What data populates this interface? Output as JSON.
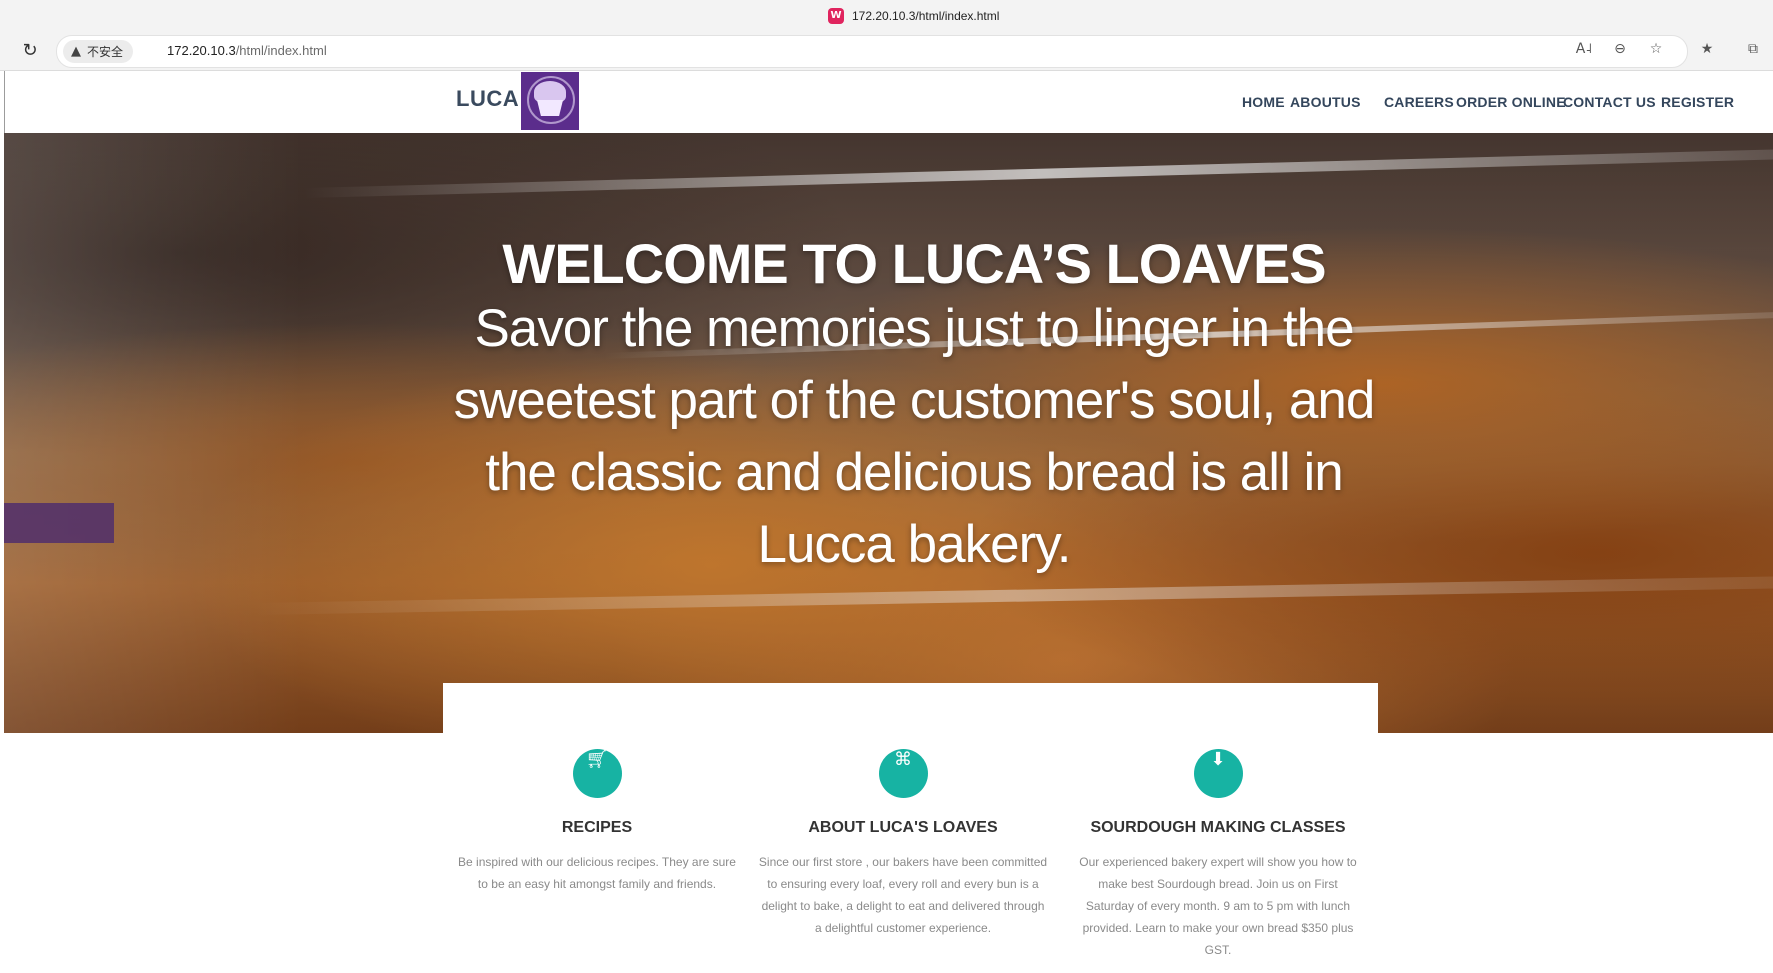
{
  "browser": {
    "tab_title": "172.20.10.3/html/index.html",
    "security_label": "不安全",
    "url_host": "172.20.10.3",
    "url_path": "/html/index.html"
  },
  "site": {
    "brand": "LUCA",
    "nav": [
      "HOME",
      "ABOUTUS",
      "CAREERS",
      "ORDER ONLINE",
      "CONTACT US",
      "REGISTER"
    ]
  },
  "hero": {
    "title": "WELCOME TO LUCA’S LOAVES",
    "subtitle": "Savor the memories just to linger in the sweetest part of the customer's soul, and the classic and delicious bread is all in Lucca bakery."
  },
  "features": [
    {
      "icon": "cart-icon",
      "title": "RECIPES",
      "text": "Be inspired with our delicious recipes. They are sure to be an easy hit amongst family and friends."
    },
    {
      "icon": "gift-icon",
      "title": "ABOUT LUCA'S LOAVES",
      "text": "Since our first store , our bakers have been committed to ensuring every loaf, every roll and every bun is a delight to bake, a delight to eat and delivered through a delightful customer experience."
    },
    {
      "icon": "download-icon",
      "title": "SOURDOUGH MAKING CLASSES",
      "text": "Our experienced bakery expert will show you how to make best Sourdough bread. Join us on First Saturday of every month. 9 am to 5 pm with lunch provided. Learn to make your own bread $350 plus GST."
    }
  ],
  "colors": {
    "accent": "#17b3a3",
    "nav_text": "#34465c",
    "logo_bg": "#5b2d8c"
  }
}
